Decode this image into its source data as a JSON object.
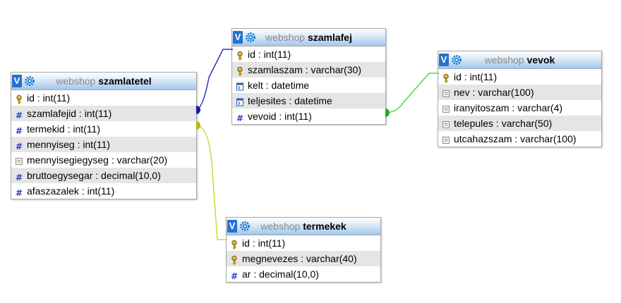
{
  "tables": {
    "szamlatetel": {
      "db": "webshop",
      "name": "szamlatetel",
      "columns": [
        {
          "text": "id : int(11)",
          "icon": "primary-key-icon"
        },
        {
          "text": "szamlafejid : int(11)",
          "icon": "hash-icon"
        },
        {
          "text": "termekid : int(11)",
          "icon": "hash-icon"
        },
        {
          "text": "mennyiseg : int(11)",
          "icon": "hash-icon"
        },
        {
          "text": "mennyisegiegyseg : varchar(20)",
          "icon": "text-field-icon"
        },
        {
          "text": "bruttoegysegar : decimal(10,0)",
          "icon": "hash-icon"
        },
        {
          "text": "afaszazalek : int(11)",
          "icon": "hash-icon"
        }
      ]
    },
    "szamlafej": {
      "db": "webshop",
      "name": "szamlafej",
      "columns": [
        {
          "text": "id : int(11)",
          "icon": "primary-key-icon"
        },
        {
          "text": "szamlaszam : varchar(30)",
          "icon": "primary-key-icon"
        },
        {
          "text": "kelt : datetime",
          "icon": "calendar-icon"
        },
        {
          "text": "teljesites : datetime",
          "icon": "calendar-icon"
        },
        {
          "text": "vevoid : int(11)",
          "icon": "hash-icon"
        }
      ]
    },
    "vevok": {
      "db": "webshop",
      "name": "vevok",
      "columns": [
        {
          "text": "id : int(11)",
          "icon": "primary-key-icon"
        },
        {
          "text": "nev : varchar(100)",
          "icon": "text-field-icon"
        },
        {
          "text": "iranyitoszam : varchar(4)",
          "icon": "text-field-icon"
        },
        {
          "text": "telepules : varchar(50)",
          "icon": "text-field-icon"
        },
        {
          "text": "utcahazszam : varchar(100)",
          "icon": "text-field-icon"
        }
      ]
    },
    "termekek": {
      "db": "webshop",
      "name": "termekek",
      "columns": [
        {
          "text": "id : int(11)",
          "icon": "primary-key-icon"
        },
        {
          "text": "megnevezes : varchar(40)",
          "icon": "primary-key-icon"
        },
        {
          "text": "ar : decimal(10,0)",
          "icon": "hash-icon"
        }
      ]
    }
  },
  "relations": [
    {
      "from": "szamlatetel.szamlafejid",
      "to": "szamlafej.id",
      "color": "#3333bb"
    },
    {
      "from": "szamlatetel.termekid",
      "to": "termekek.id",
      "color": "#d4d43a"
    },
    {
      "from": "szamlafej.vevoid",
      "to": "vevok.id",
      "color": "#44dd44"
    }
  ],
  "colors": {
    "header_grad_bottom": "#9fc6ee",
    "toggle_blue": "#2a6fd0",
    "alt_row": "#e5e5e5"
  }
}
